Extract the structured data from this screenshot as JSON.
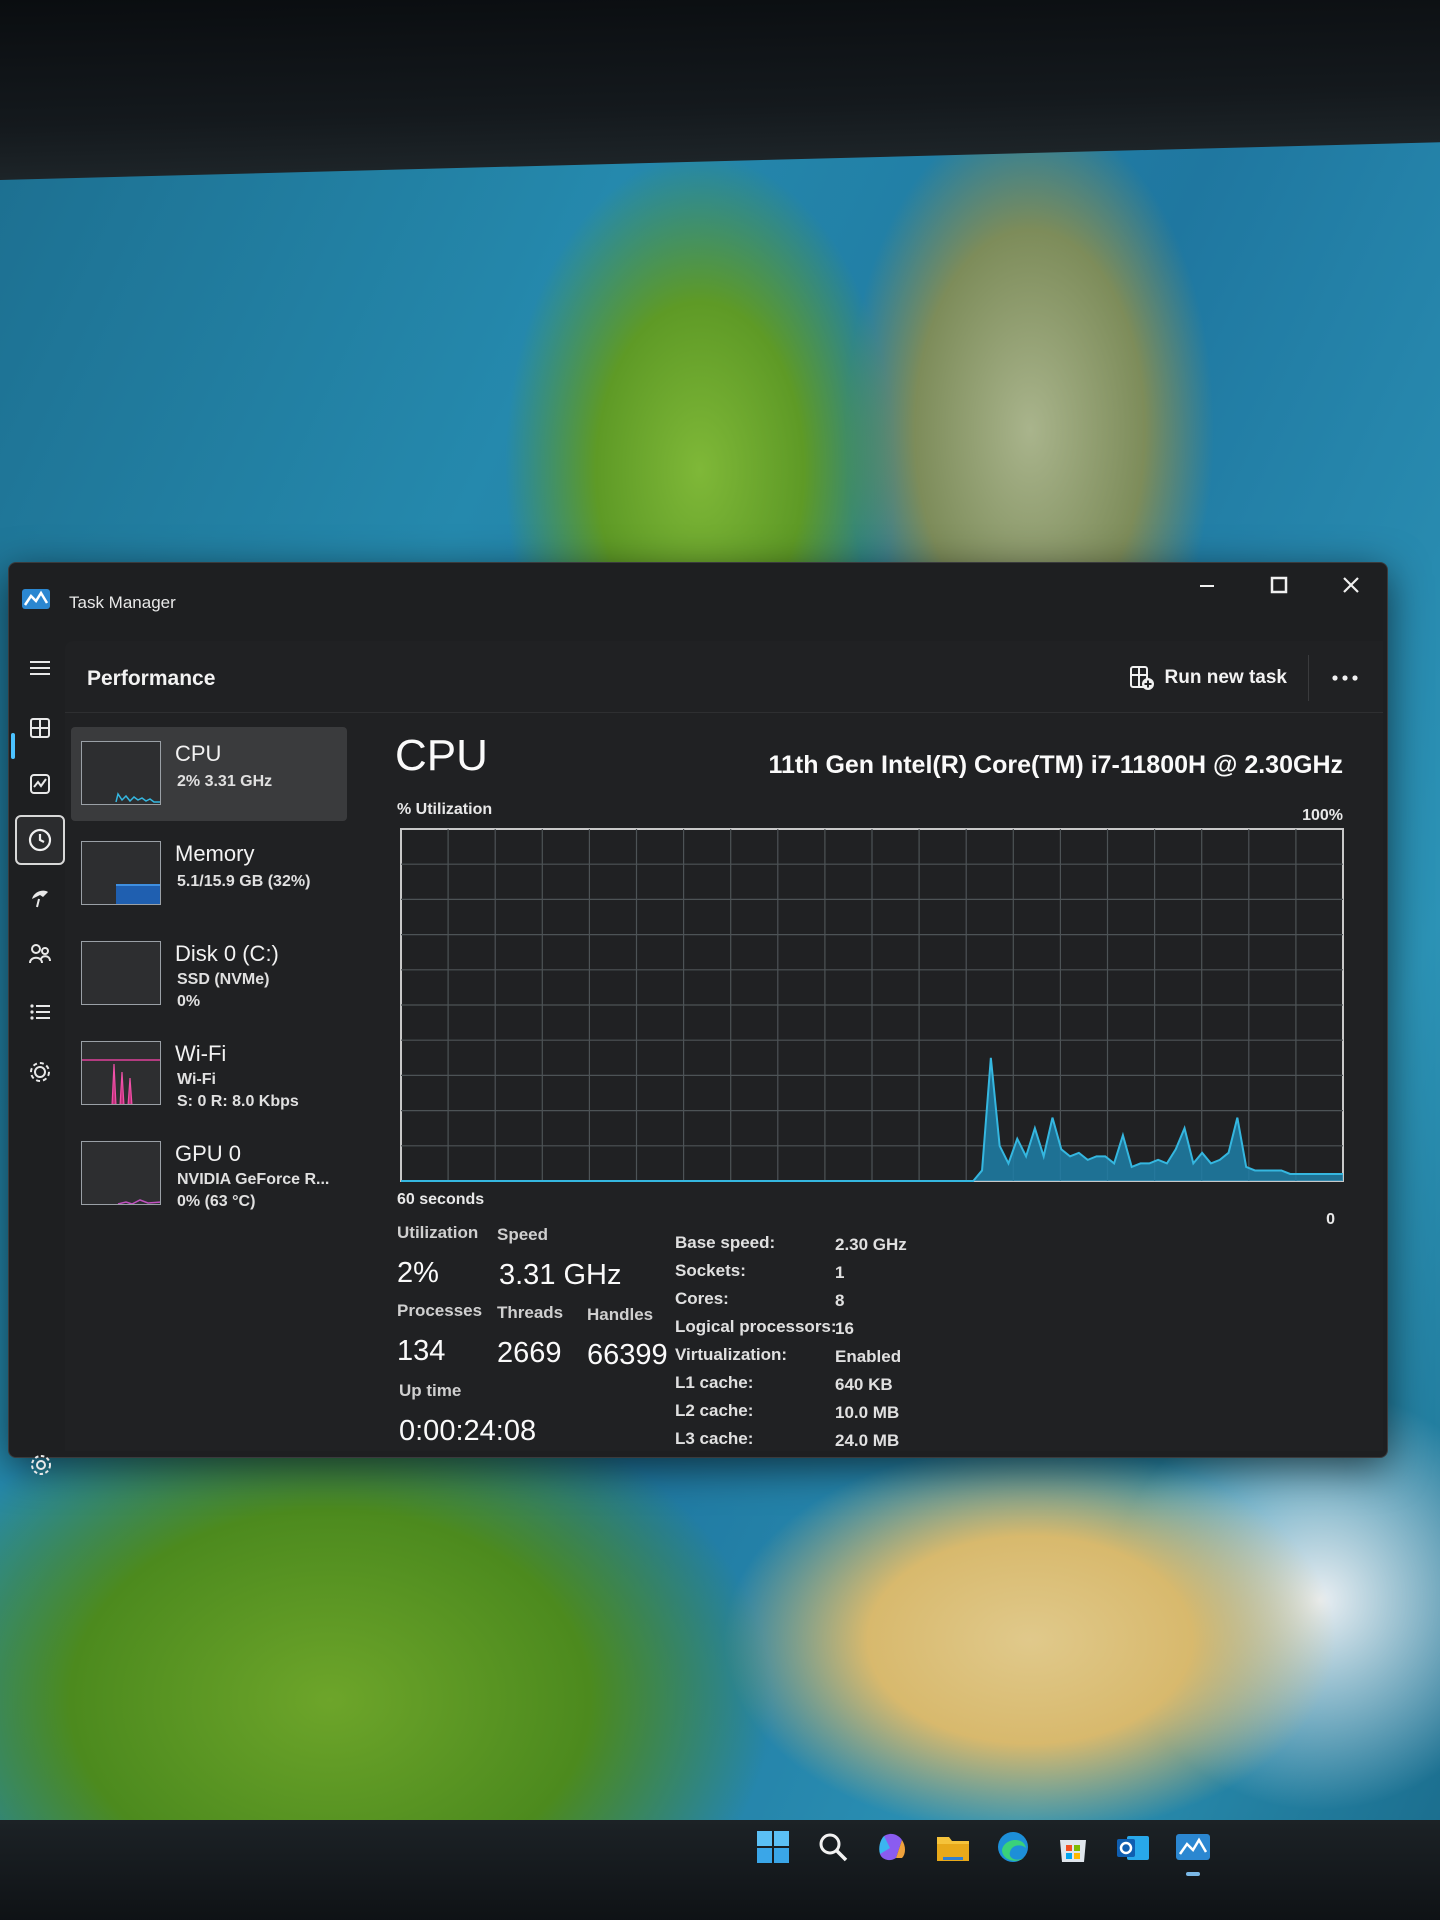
{
  "window": {
    "title": "Task Manager"
  },
  "header": {
    "page_title": "Performance",
    "run_new_task": "Run new task"
  },
  "sidebar": {
    "items": [
      {
        "name": "CPU",
        "sub1": "2% 3.31 GHz",
        "sub2": "",
        "sub3": ""
      },
      {
        "name": "Memory",
        "sub1": "5.1/15.9 GB (32%)",
        "sub2": "",
        "sub3": ""
      },
      {
        "name": "Disk 0 (C:)",
        "sub1": "SSD (NVMe)",
        "sub2": "0%",
        "sub3": ""
      },
      {
        "name": "Wi-Fi",
        "sub1": "Wi-Fi",
        "sub2": "S: 0 R: 8.0 Kbps",
        "sub3": ""
      },
      {
        "name": "GPU 0",
        "sub1": "NVIDIA GeForce R...",
        "sub2": "0% (63 °C)",
        "sub3": ""
      }
    ]
  },
  "main": {
    "title": "CPU",
    "model": "11th Gen Intel(R) Core(TM) i7-11800H @ 2.30GHz",
    "graph_y_label": "% Utilization",
    "graph_max_label": "100%",
    "graph_time_label": "60 seconds",
    "graph_min_label": "0",
    "stats": {
      "utilization_label": "Utilization",
      "utilization": "2%",
      "speed_label": "Speed",
      "speed": "3.31 GHz",
      "processes_label": "Processes",
      "processes": "134",
      "threads_label": "Threads",
      "threads": "2669",
      "handles_label": "Handles",
      "handles": "66399",
      "uptime_label": "Up time",
      "uptime": "0:00:24:08"
    },
    "specs": [
      {
        "label": "Base speed:",
        "value": "2.30 GHz"
      },
      {
        "label": "Sockets:",
        "value": "1"
      },
      {
        "label": "Cores:",
        "value": "8"
      },
      {
        "label": "Logical processors:",
        "value": "16"
      },
      {
        "label": "Virtualization:",
        "value": "Enabled"
      },
      {
        "label": "L1 cache:",
        "value": "640 KB"
      },
      {
        "label": "L2 cache:",
        "value": "10.0 MB"
      },
      {
        "label": "L3 cache:",
        "value": "24.0 MB"
      }
    ]
  },
  "chart_data": {
    "type": "area",
    "title": "",
    "xlabel": "60 seconds",
    "ylabel": "% Utilization",
    "ylim": [
      0,
      100
    ],
    "grid": true,
    "series": [
      {
        "values": [
          0,
          0,
          0,
          0,
          0,
          0,
          0,
          0,
          0,
          0,
          0,
          0,
          0,
          0,
          0,
          0,
          0,
          0,
          0,
          0,
          0,
          0,
          0,
          0,
          0,
          0,
          0,
          0,
          0,
          0,
          0,
          0,
          0,
          0,
          0,
          0,
          0,
          0,
          0,
          0,
          0,
          0,
          0,
          0,
          0,
          0,
          0,
          0,
          0,
          0,
          0,
          0,
          0,
          0,
          0,
          0,
          0,
          0,
          0,
          0,
          0,
          0,
          0,
          0,
          0,
          0,
          3,
          35,
          10,
          5,
          12,
          7,
          15,
          7,
          18,
          9,
          7,
          8,
          6,
          7,
          7,
          5,
          13,
          4,
          5,
          5,
          6,
          5,
          9,
          15,
          5,
          8,
          5,
          6,
          8,
          18,
          4,
          3,
          3,
          3,
          3,
          2,
          2,
          2,
          2,
          2,
          2,
          2
        ]
      }
    ],
    "colors": {
      "line": "#35b7e0",
      "fill": "#1f7fa8",
      "grid": "#4d5356",
      "border": "#c8c8c8"
    }
  },
  "taskbar": {
    "icons": [
      "windows-start-icon",
      "search-icon",
      "copilot-icon",
      "file-explorer-icon",
      "edge-icon",
      "store-icon",
      "outlook-icon",
      "task-manager-icon"
    ]
  }
}
